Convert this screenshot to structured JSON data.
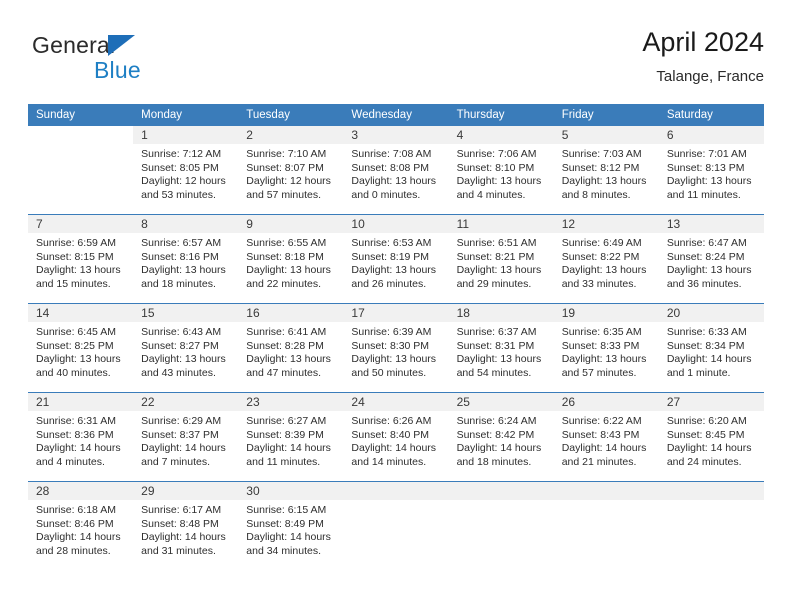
{
  "brand": {
    "name_top": "General",
    "name_bottom": "Blue",
    "accent_color": "#1e7fc4",
    "triangle_color": "#1e6eb8"
  },
  "header": {
    "title": "April 2024",
    "location": "Talange, France"
  },
  "calendar": {
    "header_bg": "#3a7cba",
    "daynum_bg": "#f1f1f1",
    "weekday_names": [
      "Sunday",
      "Monday",
      "Tuesday",
      "Wednesday",
      "Thursday",
      "Friday",
      "Saturday"
    ],
    "weeks": [
      [
        {
          "day": "",
          "empty": true,
          "no_band": true,
          "sunrise": "",
          "sunset": "",
          "daylight_1": "",
          "daylight_2": ""
        },
        {
          "day": "1",
          "sunrise": "Sunrise: 7:12 AM",
          "sunset": "Sunset: 8:05 PM",
          "daylight_1": "Daylight: 12 hours",
          "daylight_2": "and 53 minutes."
        },
        {
          "day": "2",
          "sunrise": "Sunrise: 7:10 AM",
          "sunset": "Sunset: 8:07 PM",
          "daylight_1": "Daylight: 12 hours",
          "daylight_2": "and 57 minutes."
        },
        {
          "day": "3",
          "sunrise": "Sunrise: 7:08 AM",
          "sunset": "Sunset: 8:08 PM",
          "daylight_1": "Daylight: 13 hours",
          "daylight_2": "and 0 minutes."
        },
        {
          "day": "4",
          "sunrise": "Sunrise: 7:06 AM",
          "sunset": "Sunset: 8:10 PM",
          "daylight_1": "Daylight: 13 hours",
          "daylight_2": "and 4 minutes."
        },
        {
          "day": "5",
          "sunrise": "Sunrise: 7:03 AM",
          "sunset": "Sunset: 8:12 PM",
          "daylight_1": "Daylight: 13 hours",
          "daylight_2": "and 8 minutes."
        },
        {
          "day": "6",
          "sunrise": "Sunrise: 7:01 AM",
          "sunset": "Sunset: 8:13 PM",
          "daylight_1": "Daylight: 13 hours",
          "daylight_2": "and 11 minutes."
        }
      ],
      [
        {
          "day": "7",
          "sunrise": "Sunrise: 6:59 AM",
          "sunset": "Sunset: 8:15 PM",
          "daylight_1": "Daylight: 13 hours",
          "daylight_2": "and 15 minutes."
        },
        {
          "day": "8",
          "sunrise": "Sunrise: 6:57 AM",
          "sunset": "Sunset: 8:16 PM",
          "daylight_1": "Daylight: 13 hours",
          "daylight_2": "and 18 minutes."
        },
        {
          "day": "9",
          "sunrise": "Sunrise: 6:55 AM",
          "sunset": "Sunset: 8:18 PM",
          "daylight_1": "Daylight: 13 hours",
          "daylight_2": "and 22 minutes."
        },
        {
          "day": "10",
          "sunrise": "Sunrise: 6:53 AM",
          "sunset": "Sunset: 8:19 PM",
          "daylight_1": "Daylight: 13 hours",
          "daylight_2": "and 26 minutes."
        },
        {
          "day": "11",
          "sunrise": "Sunrise: 6:51 AM",
          "sunset": "Sunset: 8:21 PM",
          "daylight_1": "Daylight: 13 hours",
          "daylight_2": "and 29 minutes."
        },
        {
          "day": "12",
          "sunrise": "Sunrise: 6:49 AM",
          "sunset": "Sunset: 8:22 PM",
          "daylight_1": "Daylight: 13 hours",
          "daylight_2": "and 33 minutes."
        },
        {
          "day": "13",
          "sunrise": "Sunrise: 6:47 AM",
          "sunset": "Sunset: 8:24 PM",
          "daylight_1": "Daylight: 13 hours",
          "daylight_2": "and 36 minutes."
        }
      ],
      [
        {
          "day": "14",
          "sunrise": "Sunrise: 6:45 AM",
          "sunset": "Sunset: 8:25 PM",
          "daylight_1": "Daylight: 13 hours",
          "daylight_2": "and 40 minutes."
        },
        {
          "day": "15",
          "sunrise": "Sunrise: 6:43 AM",
          "sunset": "Sunset: 8:27 PM",
          "daylight_1": "Daylight: 13 hours",
          "daylight_2": "and 43 minutes."
        },
        {
          "day": "16",
          "sunrise": "Sunrise: 6:41 AM",
          "sunset": "Sunset: 8:28 PM",
          "daylight_1": "Daylight: 13 hours",
          "daylight_2": "and 47 minutes."
        },
        {
          "day": "17",
          "sunrise": "Sunrise: 6:39 AM",
          "sunset": "Sunset: 8:30 PM",
          "daylight_1": "Daylight: 13 hours",
          "daylight_2": "and 50 minutes."
        },
        {
          "day": "18",
          "sunrise": "Sunrise: 6:37 AM",
          "sunset": "Sunset: 8:31 PM",
          "daylight_1": "Daylight: 13 hours",
          "daylight_2": "and 54 minutes."
        },
        {
          "day": "19",
          "sunrise": "Sunrise: 6:35 AM",
          "sunset": "Sunset: 8:33 PM",
          "daylight_1": "Daylight: 13 hours",
          "daylight_2": "and 57 minutes."
        },
        {
          "day": "20",
          "sunrise": "Sunrise: 6:33 AM",
          "sunset": "Sunset: 8:34 PM",
          "daylight_1": "Daylight: 14 hours",
          "daylight_2": "and 1 minute."
        }
      ],
      [
        {
          "day": "21",
          "sunrise": "Sunrise: 6:31 AM",
          "sunset": "Sunset: 8:36 PM",
          "daylight_1": "Daylight: 14 hours",
          "daylight_2": "and 4 minutes."
        },
        {
          "day": "22",
          "sunrise": "Sunrise: 6:29 AM",
          "sunset": "Sunset: 8:37 PM",
          "daylight_1": "Daylight: 14 hours",
          "daylight_2": "and 7 minutes."
        },
        {
          "day": "23",
          "sunrise": "Sunrise: 6:27 AM",
          "sunset": "Sunset: 8:39 PM",
          "daylight_1": "Daylight: 14 hours",
          "daylight_2": "and 11 minutes."
        },
        {
          "day": "24",
          "sunrise": "Sunrise: 6:26 AM",
          "sunset": "Sunset: 8:40 PM",
          "daylight_1": "Daylight: 14 hours",
          "daylight_2": "and 14 minutes."
        },
        {
          "day": "25",
          "sunrise": "Sunrise: 6:24 AM",
          "sunset": "Sunset: 8:42 PM",
          "daylight_1": "Daylight: 14 hours",
          "daylight_2": "and 18 minutes."
        },
        {
          "day": "26",
          "sunrise": "Sunrise: 6:22 AM",
          "sunset": "Sunset: 8:43 PM",
          "daylight_1": "Daylight: 14 hours",
          "daylight_2": "and 21 minutes."
        },
        {
          "day": "27",
          "sunrise": "Sunrise: 6:20 AM",
          "sunset": "Sunset: 8:45 PM",
          "daylight_1": "Daylight: 14 hours",
          "daylight_2": "and 24 minutes."
        }
      ],
      [
        {
          "day": "28",
          "sunrise": "Sunrise: 6:18 AM",
          "sunset": "Sunset: 8:46 PM",
          "daylight_1": "Daylight: 14 hours",
          "daylight_2": "and 28 minutes."
        },
        {
          "day": "29",
          "sunrise": "Sunrise: 6:17 AM",
          "sunset": "Sunset: 8:48 PM",
          "daylight_1": "Daylight: 14 hours",
          "daylight_2": "and 31 minutes."
        },
        {
          "day": "30",
          "sunrise": "Sunrise: 6:15 AM",
          "sunset": "Sunset: 8:49 PM",
          "daylight_1": "Daylight: 14 hours",
          "daylight_2": "and 34 minutes."
        },
        {
          "day": "",
          "empty": true,
          "sunrise": "",
          "sunset": "",
          "daylight_1": "",
          "daylight_2": ""
        },
        {
          "day": "",
          "empty": true,
          "sunrise": "",
          "sunset": "",
          "daylight_1": "",
          "daylight_2": ""
        },
        {
          "day": "",
          "empty": true,
          "sunrise": "",
          "sunset": "",
          "daylight_1": "",
          "daylight_2": ""
        },
        {
          "day": "",
          "empty": true,
          "sunrise": "",
          "sunset": "",
          "daylight_1": "",
          "daylight_2": ""
        }
      ]
    ]
  }
}
